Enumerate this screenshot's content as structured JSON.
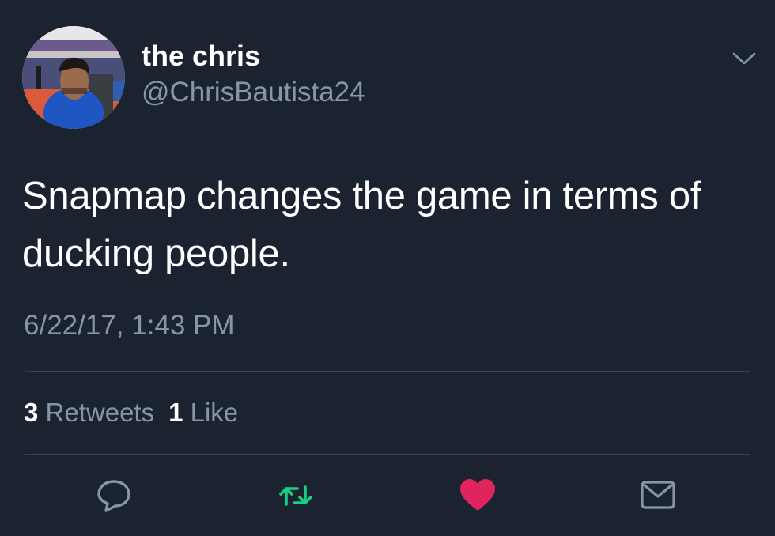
{
  "user": {
    "display_name": "the chris",
    "handle": "@ChrisBautista24",
    "avatar_icon": "profile-photo"
  },
  "tweet": {
    "text": "Snapmap changes the game in terms of ducking people.",
    "timestamp": "6/22/17, 1:43 PM"
  },
  "stats": {
    "retweets_count": "3",
    "retweets_label": "Retweets",
    "likes_count": "1",
    "likes_label": "Like"
  },
  "actions": {
    "reply_icon": "speech-bubble",
    "retweet_icon": "retweet-arrows",
    "like_icon": "heart",
    "dm_icon": "envelope"
  },
  "menu_icon": "chevron-down",
  "colors": {
    "background": "#1b2330",
    "primary_text": "#ffffff",
    "secondary_text": "#8796a5",
    "divider": "#38444d",
    "retweet_active": "#19cf86",
    "like_active": "#e0245e"
  }
}
